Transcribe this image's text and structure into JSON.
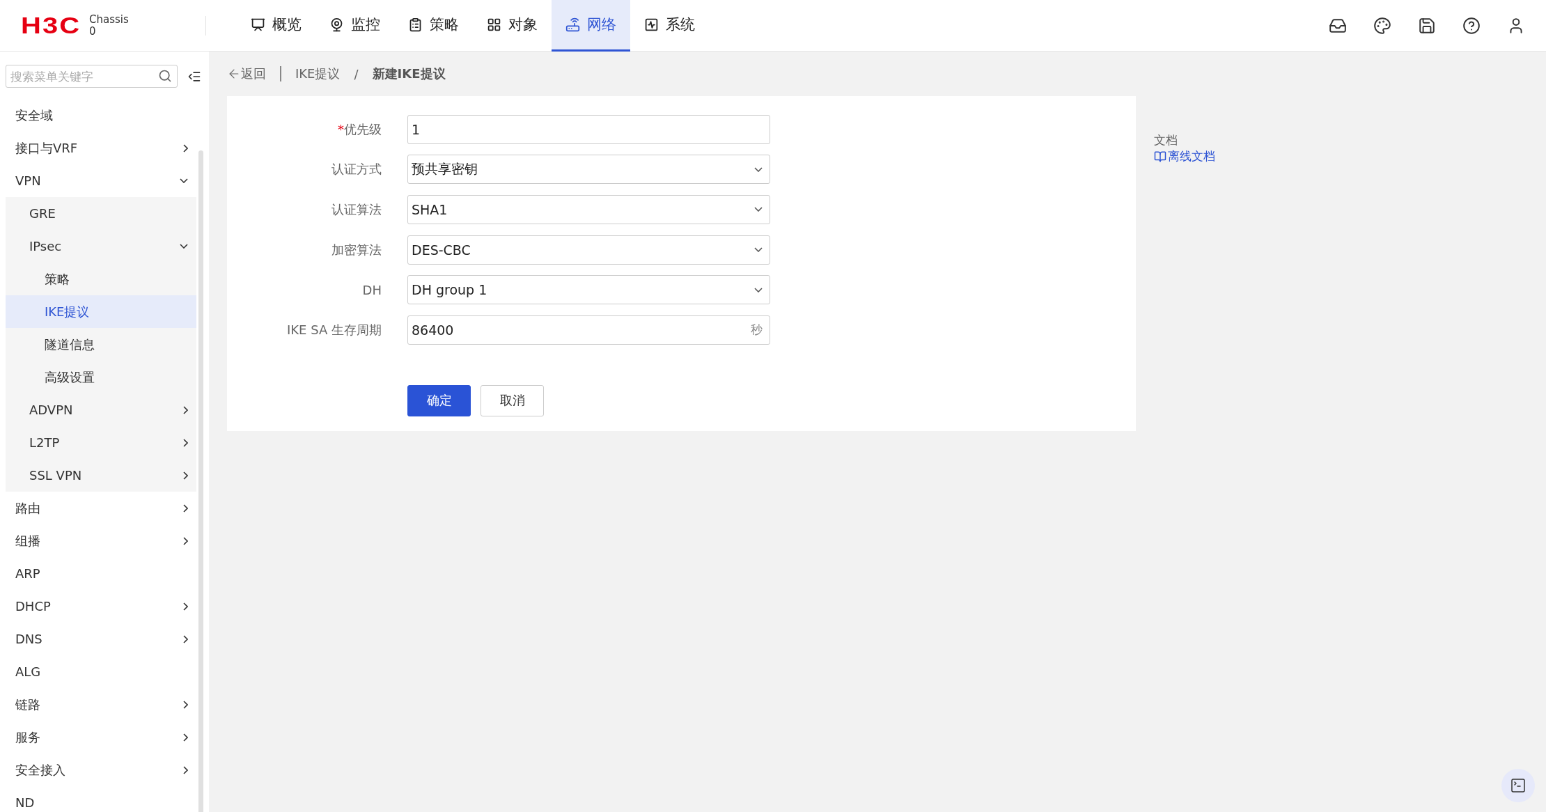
{
  "header": {
    "logo": "H3C",
    "device": {
      "line1": "Chassis",
      "line2": "0"
    },
    "nav": [
      {
        "label": "概览",
        "selected": false
      },
      {
        "label": "监控",
        "selected": false
      },
      {
        "label": "策略",
        "selected": false
      },
      {
        "label": "对象",
        "selected": false
      },
      {
        "label": "网络",
        "selected": true
      },
      {
        "label": "系统",
        "selected": false
      }
    ]
  },
  "sidebar": {
    "search": {
      "placeholder": "搜索菜单关键字"
    },
    "items": [
      {
        "label": "安全域",
        "selected": false
      },
      {
        "label": "接口与VRF",
        "selected": false,
        "expanded": false
      },
      {
        "label": "VPN",
        "selected": false,
        "expanded": true,
        "children": [
          {
            "label": "GRE",
            "selected": false
          },
          {
            "label": "IPsec",
            "selected": false,
            "expanded": true,
            "children": [
              {
                "label": "策略",
                "selected": false
              },
              {
                "label": "IKE提议",
                "selected": true
              },
              {
                "label": "隧道信息",
                "selected": false
              },
              {
                "label": "高级设置",
                "selected": false
              }
            ]
          },
          {
            "label": "ADVPN",
            "selected": false,
            "expanded": false
          },
          {
            "label": "L2TP",
            "selected": false,
            "expanded": false
          },
          {
            "label": "SSL VPN",
            "selected": false,
            "expanded": false
          }
        ]
      },
      {
        "label": "路由",
        "selected": false,
        "expanded": false
      },
      {
        "label": "组播",
        "selected": false,
        "expanded": false
      },
      {
        "label": "ARP",
        "selected": false
      },
      {
        "label": "DHCP",
        "selected": false,
        "expanded": false
      },
      {
        "label": "DNS",
        "selected": false,
        "expanded": false
      },
      {
        "label": "ALG",
        "selected": false
      },
      {
        "label": "链路",
        "selected": false,
        "expanded": false
      },
      {
        "label": "服务",
        "selected": false,
        "expanded": false
      },
      {
        "label": "安全接入",
        "selected": false,
        "expanded": false
      },
      {
        "label": "ND",
        "selected": false
      }
    ]
  },
  "breadcrumb": {
    "back": "返回",
    "parent": "IKE提议",
    "separator": "/",
    "current": "新建IKE提议"
  },
  "form": {
    "fields": [
      {
        "label": "优先级",
        "required_mark": "*",
        "kind": "input",
        "value": "1"
      },
      {
        "label": "认证方式",
        "kind": "select",
        "value": "预共享密钥"
      },
      {
        "label": "认证算法",
        "kind": "select",
        "value": "SHA1"
      },
      {
        "label": "加密算法",
        "kind": "select",
        "value": "DES-CBC"
      },
      {
        "label": "DH",
        "kind": "select",
        "value": "DH group 1"
      },
      {
        "label": "IKE SA 生存周期",
        "kind": "input",
        "value": "86400",
        "unit": "秒"
      }
    ],
    "buttons": [
      {
        "label": "确定",
        "kind": "primary"
      },
      {
        "label": "取消",
        "kind": "default"
      }
    ]
  },
  "docs": {
    "title": "文档",
    "link": "离线文档"
  }
}
